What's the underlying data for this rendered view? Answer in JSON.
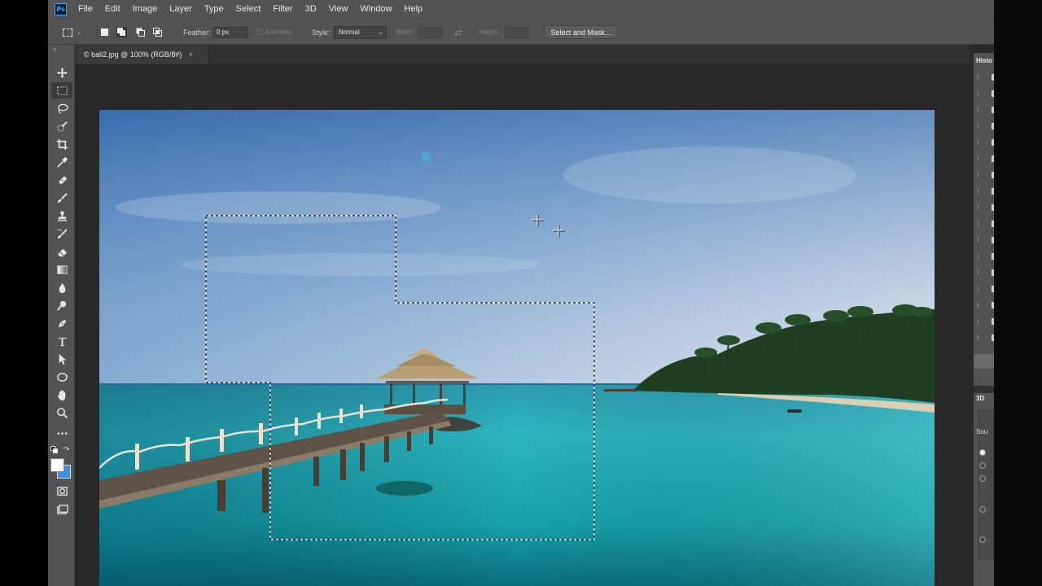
{
  "app": {
    "logo": "Ps"
  },
  "menu": [
    "File",
    "Edit",
    "Image",
    "Layer",
    "Type",
    "Select",
    "Filter",
    "3D",
    "View",
    "Window",
    "Help"
  ],
  "options": {
    "feather_label": "Feather:",
    "feather_value": "0 px",
    "antialias_label": "Anti-alias",
    "style_label": "Style:",
    "style_value": "Normal",
    "width_label": "Width:",
    "height_label": "Height:",
    "select_mask_label": "Select and Mask..."
  },
  "document": {
    "tab_label": "© bali2.jpg @ 100% (RGB/8#)",
    "close_glyph": "×"
  },
  "tools": [
    "move-tool",
    "rectangular-marquee-tool",
    "lasso-tool",
    "quick-selection-tool",
    "crop-tool",
    "eyedropper-tool",
    "spot-healing-tool",
    "brush-tool",
    "clone-stamp-tool",
    "history-brush-tool",
    "eraser-tool",
    "gradient-tool",
    "blur-tool",
    "dodge-tool",
    "pen-tool",
    "type-tool",
    "path-selection-tool",
    "ellipse-tool",
    "hand-tool",
    "zoom-tool",
    "edit-toolbar",
    "default-colors",
    "swap-colors",
    "foreground-color",
    "background-color",
    "quick-mask",
    "screen-mode"
  ],
  "colors": {
    "foreground": "#ffffff",
    "background": "#3f8ee6",
    "accent": "#31a8ff"
  },
  "panels": {
    "history_title": "Histo",
    "threed_title": "3D",
    "source_label": "Sou"
  }
}
